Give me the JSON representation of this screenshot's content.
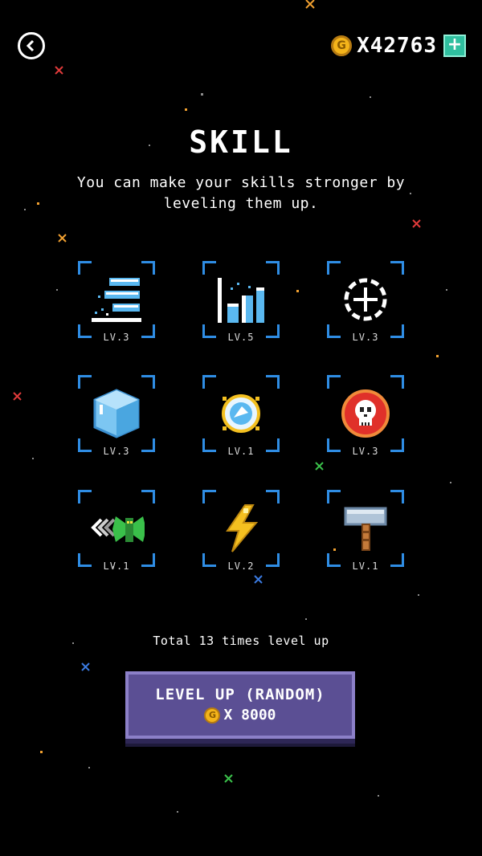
{
  "header": {
    "coin_prefix": "X",
    "coin_amount": "42763",
    "coin_symbol": "G",
    "plus_label": "+"
  },
  "title": "SKILL",
  "subtitle": "You can make your skills stronger by leveling them up.",
  "skills": [
    {
      "icon": "speed-bars-icon",
      "level": "LV.3"
    },
    {
      "icon": "bar-graph-icon",
      "level": "LV.5"
    },
    {
      "icon": "crosshair-icon",
      "level": "LV.3"
    },
    {
      "icon": "ice-cube-icon",
      "level": "LV.3"
    },
    {
      "icon": "shield-orb-icon",
      "level": "LV.1"
    },
    {
      "icon": "skull-icon",
      "level": "LV.3"
    },
    {
      "icon": "drone-wings-icon",
      "level": "LV.1"
    },
    {
      "icon": "lightning-icon",
      "level": "LV.2"
    },
    {
      "icon": "hammer-icon",
      "level": "LV.1"
    }
  ],
  "total_text": "Total 13 times level up",
  "level_up_button": {
    "label": "LEVEL UP (RANDOM)",
    "cost_symbol": "G",
    "cost_prefix": "X",
    "cost": "8000"
  },
  "colors": {
    "background": "#000000",
    "bracket": "#2f8de4",
    "button": "#5b4f94",
    "coin": "#f4b41a"
  }
}
